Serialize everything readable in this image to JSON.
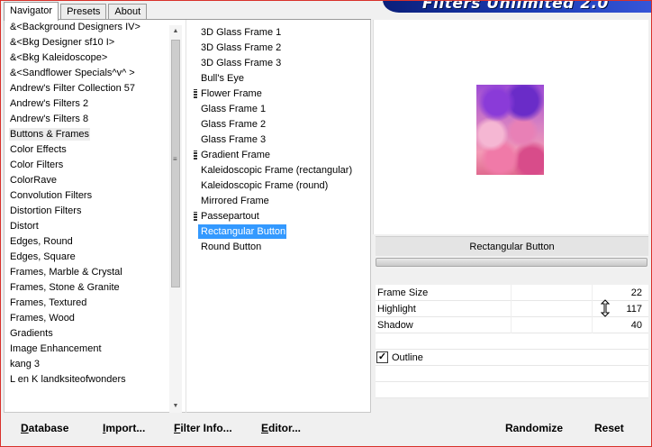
{
  "tabs": [
    {
      "label": "Navigator",
      "active": true
    },
    {
      "label": "Presets",
      "active": false
    },
    {
      "label": "About",
      "active": false
    }
  ],
  "banner": {
    "title": "Filters Unlimited 2.0"
  },
  "categories": [
    {
      "label": "&<Background Designers IV>"
    },
    {
      "label": "&<Bkg Designer sf10 I>"
    },
    {
      "label": "&<Bkg Kaleidoscope>"
    },
    {
      "label": "&<Sandflower Specials^v^ >"
    },
    {
      "label": "Andrew's Filter Collection 57"
    },
    {
      "label": "Andrew's Filters 2"
    },
    {
      "label": "Andrew's Filters 8"
    },
    {
      "label": "Buttons & Frames"
    },
    {
      "label": "Color Effects"
    },
    {
      "label": "Color Filters"
    },
    {
      "label": "ColorRave"
    },
    {
      "label": "Convolution Filters"
    },
    {
      "label": "Distortion Filters"
    },
    {
      "label": "Distort"
    },
    {
      "label": "Edges, Round"
    },
    {
      "label": "Edges, Square"
    },
    {
      "label": "Frames, Marble & Crystal"
    },
    {
      "label": "Frames, Stone & Granite"
    },
    {
      "label": "Frames, Textured"
    },
    {
      "label": "Frames, Wood"
    },
    {
      "label": "Gradients"
    },
    {
      "label": "Image Enhancement"
    },
    {
      "label": "kang 3"
    },
    {
      "label": "L en K landksiteofwonders"
    }
  ],
  "selected_category": "Buttons & Frames",
  "filters": [
    {
      "label": "3D Glass Frame 1",
      "marker": false
    },
    {
      "label": "3D Glass Frame 2",
      "marker": false
    },
    {
      "label": "3D Glass Frame 3",
      "marker": false
    },
    {
      "label": "Bull's Eye",
      "marker": false
    },
    {
      "label": "Flower Frame",
      "marker": true
    },
    {
      "label": "Glass Frame 1",
      "marker": false
    },
    {
      "label": "Glass Frame 2",
      "marker": false
    },
    {
      "label": "Glass Frame 3",
      "marker": false
    },
    {
      "label": "Gradient Frame",
      "marker": true
    },
    {
      "label": "Kaleidoscopic Frame (rectangular)",
      "marker": false
    },
    {
      "label": "Kaleidoscopic Frame (round)",
      "marker": false
    },
    {
      "label": "Mirrored Frame",
      "marker": false
    },
    {
      "label": "Passepartout",
      "marker": true
    },
    {
      "label": "Rectangular Button",
      "marker": false
    },
    {
      "label": "Round Button",
      "marker": false
    }
  ],
  "selected_filter": "Rectangular Button",
  "filter_title": "Rectangular Button",
  "params": [
    {
      "label": "Frame Size",
      "value": "22"
    },
    {
      "label": "Highlight",
      "value": "117"
    },
    {
      "label": "Shadow",
      "value": "40"
    }
  ],
  "outline": {
    "label": "Outline",
    "checked": true
  },
  "buttons": {
    "database": {
      "hotkey": "D",
      "rest": "atabase"
    },
    "import": {
      "hotkey": "I",
      "rest": "mport..."
    },
    "filter_info": {
      "hotkey": "F",
      "rest": "ilter Info..."
    },
    "editor": {
      "hotkey": "E",
      "rest": "ditor..."
    },
    "randomize": "Randomize",
    "reset": "Reset"
  }
}
